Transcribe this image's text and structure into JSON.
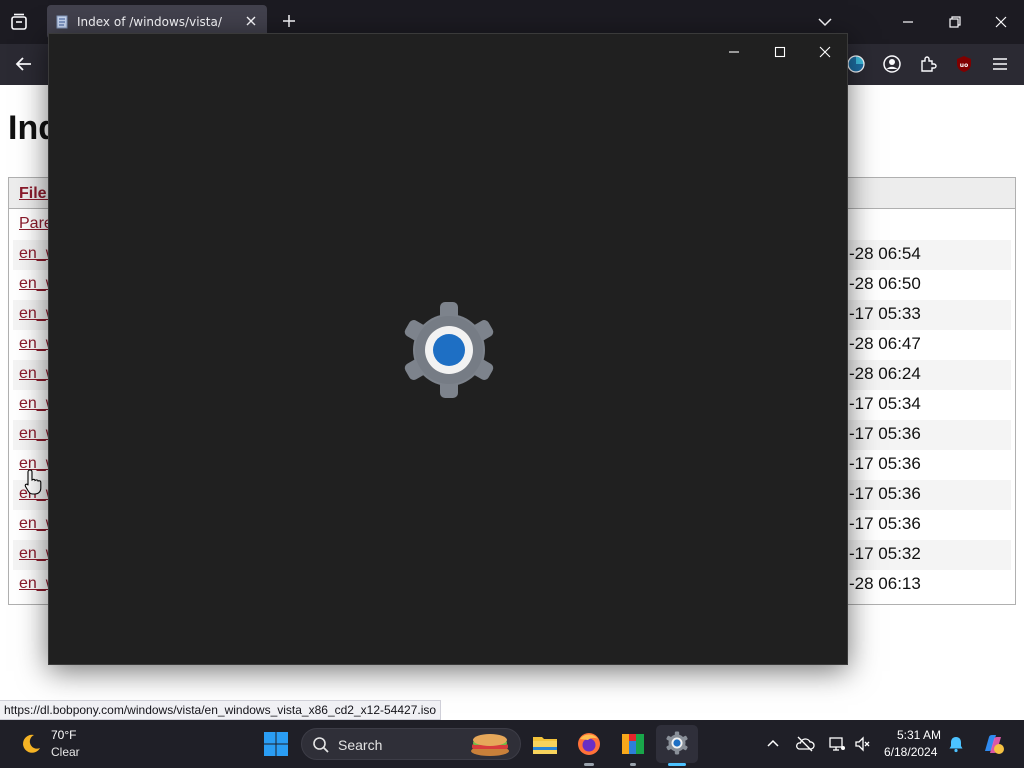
{
  "browser": {
    "tab": {
      "title": "Index of /windows/vista/"
    },
    "status_url": "https://dl.bobpony.com/windows/vista/en_windows_vista_x86_cd2_x12-54427.iso"
  },
  "page": {
    "heading": "Index of /windows/vista/",
    "table": {
      "header_file": "File Name",
      "parent_link": "Parent directory/",
      "rows": [
        {
          "name": "en_windows_vista",
          "date_visible": "-28 06:54"
        },
        {
          "name": "en_windows_vista",
          "date_visible": "-28 06:50"
        },
        {
          "name": "en_windows_vista",
          "date_visible": "-17 05:33"
        },
        {
          "name": "en_windows_vista",
          "date_visible": "-28 06:47"
        },
        {
          "name": "en_windows_vista",
          "date_visible": "-28 06:24"
        },
        {
          "name": "en_windows_vista",
          "date_visible": "-17 05:34"
        },
        {
          "name": "en_windows_vista",
          "date_visible": "-17 05:36"
        },
        {
          "name": "en_windows_vista",
          "date_visible": "-17 05:36"
        },
        {
          "name": "en_windows_vista",
          "date_visible": "-17 05:36"
        },
        {
          "name": "en_windows_vista",
          "date_visible": "-17 05:36"
        },
        {
          "name": "en_windows_vista",
          "date_visible": "-17 05:32"
        },
        {
          "name": "en_windows_vista",
          "date_visible": "-28 06:13"
        }
      ]
    }
  },
  "overlay_window": {
    "icon": "settings-gear-icon"
  },
  "taskbar": {
    "weather": {
      "temp": "70°F",
      "condition": "Clear"
    },
    "search_placeholder": "Search",
    "clock": {
      "time": "5:31 AM",
      "date": "6/18/2024"
    }
  },
  "colors": {
    "link": "#8b1a2b",
    "chrome_dark": "#1c1b22",
    "overlay_bg": "#202020",
    "gear_blue": "#1e6fc4"
  }
}
